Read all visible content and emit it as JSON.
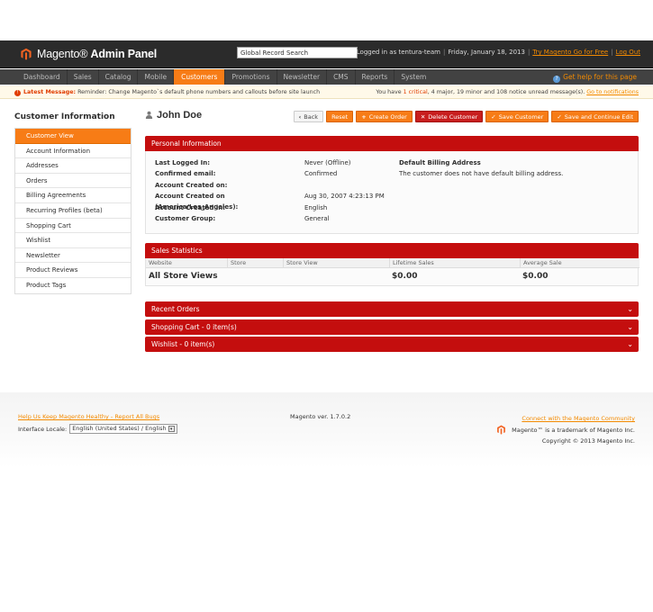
{
  "header": {
    "logo_brand": "Magento",
    "logo_panel": "Admin Panel",
    "search_value": "Global Record Search",
    "logged_in": "Logged in as tentura-team",
    "date": "Friday, January 18, 2013",
    "try_link": "Try Magento Go for Free",
    "logout": "Log Out"
  },
  "nav": {
    "items": [
      "Dashboard",
      "Sales",
      "Catalog",
      "Mobile",
      "Customers",
      "Promotions",
      "Newsletter",
      "CMS",
      "Reports",
      "System"
    ],
    "active": "Customers",
    "help": "Get help for this page"
  },
  "notification": {
    "label": "Latest Message:",
    "message": "Reminder: Change Magento`s default phone numbers and callouts before site launch",
    "you_have": "You have",
    "critical": "1 critical",
    "rest": ", 4 major, 19 minor and 108 notice unread message(s).",
    "link": "Go to notifications"
  },
  "sidebar": {
    "title": "Customer Information",
    "items": [
      "Customer View",
      "Account Information",
      "Addresses",
      "Orders",
      "Billing Agreements",
      "Recurring Profiles (beta)",
      "Shopping Cart",
      "Wishlist",
      "Newsletter",
      "Product Reviews",
      "Product Tags"
    ]
  },
  "page": {
    "title": "John Doe",
    "buttons": {
      "back": "Back",
      "reset": "Reset",
      "create_order": "Create Order",
      "delete": "Delete Customer",
      "save": "Save Customer",
      "save_continue": "Save and Continue Edit"
    }
  },
  "personal": {
    "heading": "Personal Information",
    "rows": [
      {
        "label": "Last Logged In:",
        "value": "Never (Offline)"
      },
      {
        "label": "Confirmed email:",
        "value": "Confirmed"
      },
      {
        "label": "Account Created on:",
        "value": ""
      },
      {
        "label": "Account Created on (America/Los_Angeles):",
        "value": "Aug 30, 2007 4:23:13 PM"
      },
      {
        "label": "Account Created in:",
        "value": "English"
      },
      {
        "label": "Customer Group:",
        "value": "General"
      }
    ],
    "billing_heading": "Default Billing Address",
    "billing_text": "The customer does not have default billing address."
  },
  "sales": {
    "heading": "Sales Statistics",
    "columns": [
      "Website",
      "Store",
      "Store View",
      "Lifetime Sales",
      "Average Sale"
    ],
    "row": {
      "label": "All Store Views",
      "lifetime": "$0.00",
      "average": "$0.00"
    }
  },
  "collapsed": [
    "Recent Orders",
    "Shopping Cart - 0 item(s)",
    "Wishlist - 0 item(s)"
  ],
  "footer": {
    "help_link": "Help Us Keep Magento Healthy - Report All Bugs",
    "locale_label": "Interface Locale:",
    "locale_value": "English (United States) / English",
    "version": "Magento ver. 1.7.0.2",
    "community_link": "Connect with the Magento Community",
    "trademark": "Magento™ is a trademark of Magento Inc.",
    "copyright": "Copyright © 2013 Magento Inc."
  },
  "colors": {
    "accent": "#f77c16",
    "section_red": "#c40e0e",
    "header_bg": "#2b2b2b"
  }
}
